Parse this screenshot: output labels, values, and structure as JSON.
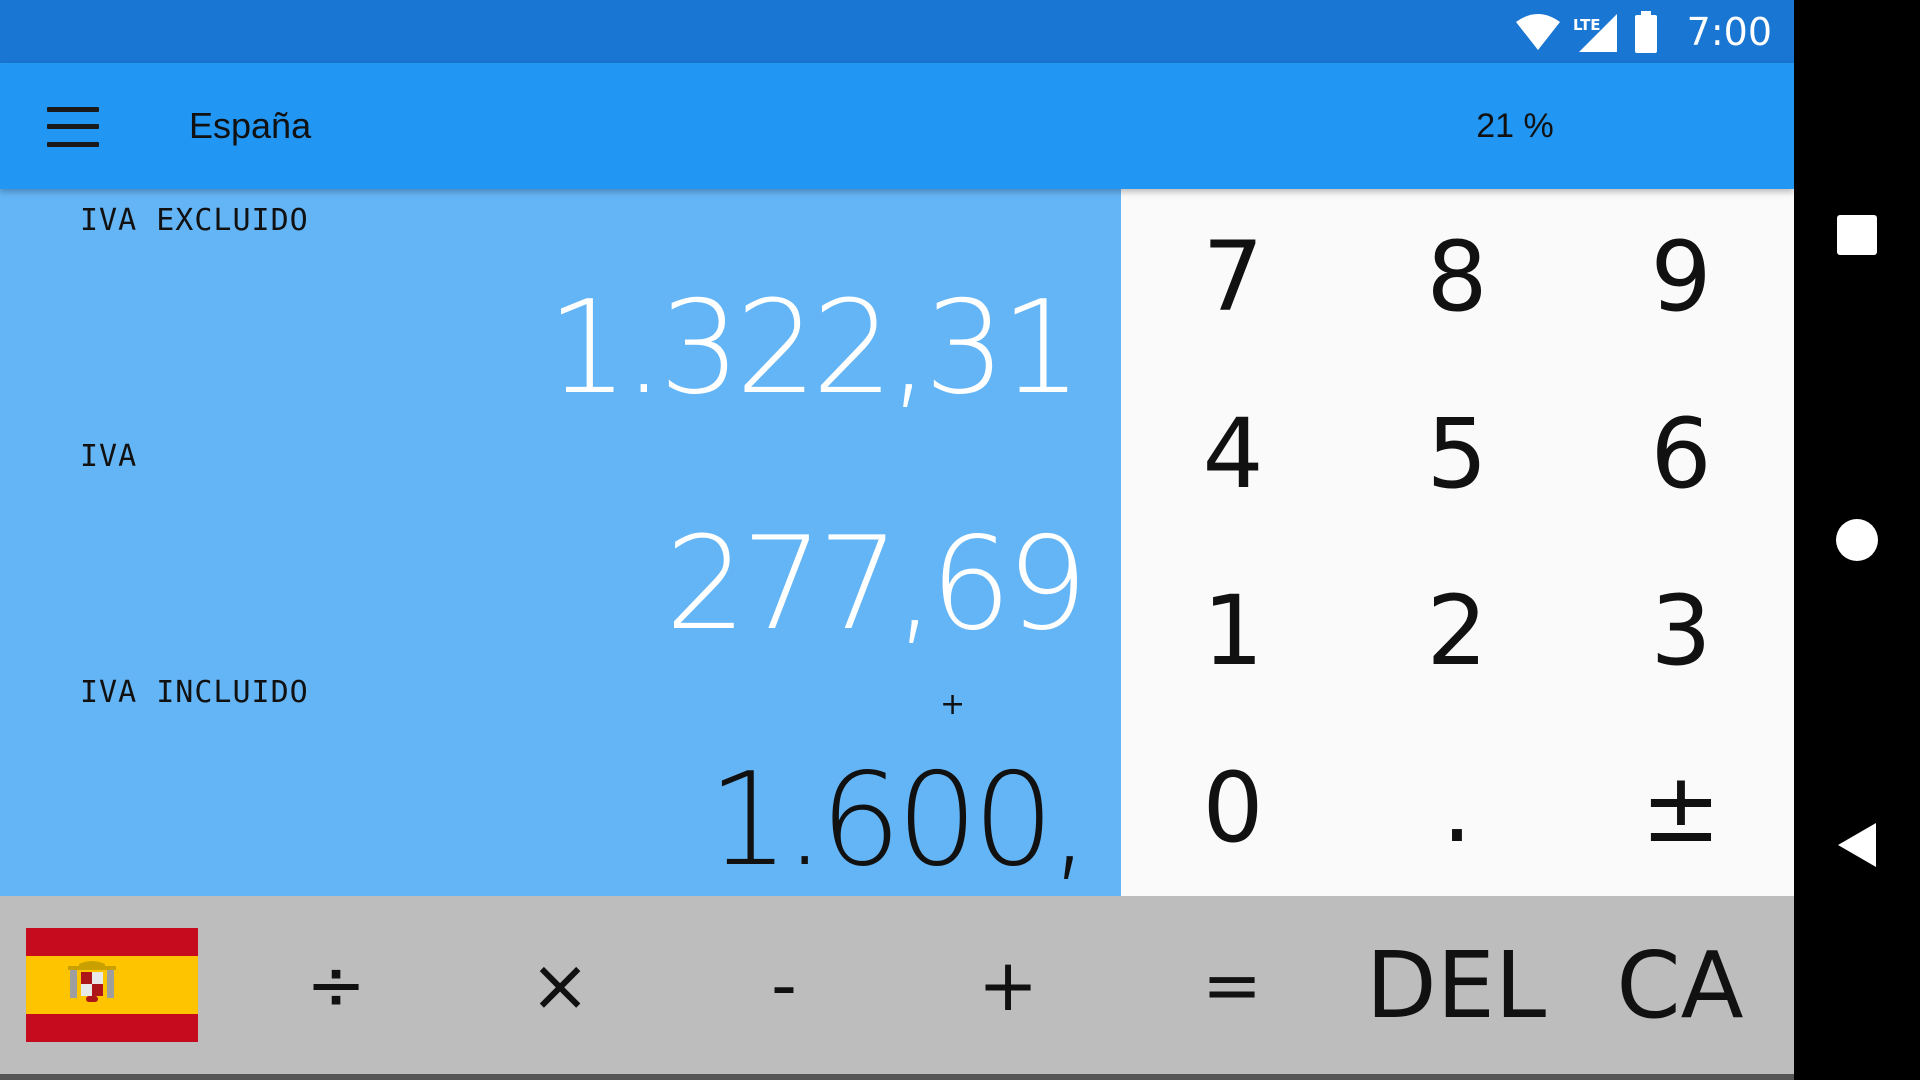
{
  "status_bar": {
    "network_label": "LTE",
    "time": "7:00",
    "icons": [
      "wifi-icon",
      "cell-signal-icon",
      "battery-icon"
    ]
  },
  "app_bar": {
    "menu_icon": "menu-icon",
    "title": "España",
    "rate": "21 %"
  },
  "results": {
    "excluded_label": "IVA EXCLUIDO",
    "excluded_value": "1.322,31",
    "tax_label": "IVA",
    "tax_value": "277,69",
    "included_label": "IVA INCLUIDO",
    "operator_indicator": "+",
    "included_value": "1.600,"
  },
  "keypad": {
    "keys": [
      "7",
      "8",
      "9",
      "4",
      "5",
      "6",
      "1",
      "2",
      "3",
      "0",
      ".",
      "±"
    ]
  },
  "operators": {
    "flag_icon": "spain-flag-icon",
    "divide": "÷",
    "multiply": "×",
    "minus": "-",
    "plus": "+",
    "equals": "=",
    "delete": "DEL",
    "clear_all": "CA"
  },
  "nav_bar": {
    "icons": [
      "recents-square-icon",
      "home-circle-icon",
      "back-triangle-icon"
    ]
  },
  "colors": {
    "status_bar": "#1976d2",
    "app_bar": "#2196f3",
    "results_panel": "#64b5f6",
    "keypad": "#fafafa",
    "operator_row": "#bdbdbd",
    "flag_red": "#c60b1e",
    "flag_yellow": "#ffc400"
  }
}
